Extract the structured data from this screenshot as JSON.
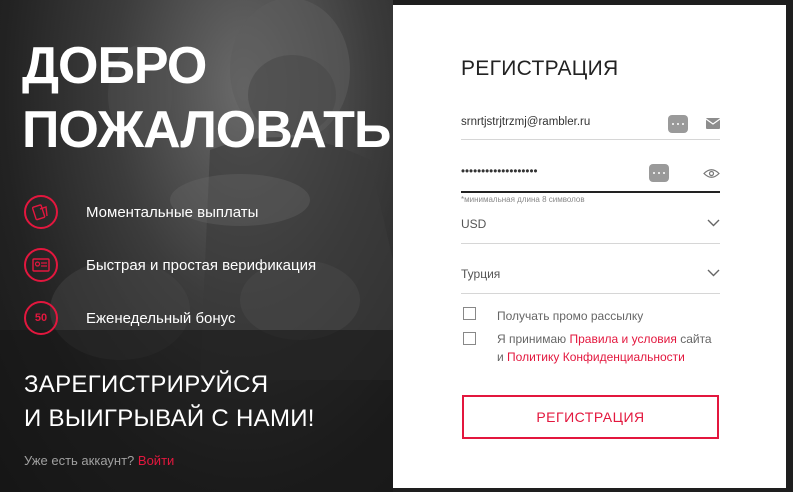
{
  "promo": {
    "title_line1": "ДОБРО",
    "title_line2": "ПОЖАЛОВАТЬ!",
    "features": [
      {
        "icon": "coins-icon",
        "text": "Моментальные выплаты"
      },
      {
        "icon": "id-card-icon",
        "text": "Быстрая и простая верификация"
      },
      {
        "icon": "fifty-percent-icon",
        "icon_text": "50",
        "text": "Еженедельный бонус"
      }
    ],
    "slogan_line1": "ЗАРЕГИСТРИРУЙСЯ",
    "slogan_line2": "И ВЫИГРЫВАЙ С НАМИ!",
    "account_prompt": "Уже есть аккаунт?",
    "login_link": "Войти"
  },
  "form": {
    "title": "РЕГИСТРАЦИЯ",
    "email_value": "srnrtjstrjtrzmj@rambler.ru",
    "password_value": "•••••••••••••••••••",
    "password_hint": "*минимальная длина 8 символов",
    "currency": "USD",
    "country": "Турция",
    "promo_checkbox_label": "Получать промо рассылку",
    "terms_prefix": "Я принимаю",
    "terms_link": "Правила и условия",
    "terms_mid": "сайта",
    "terms_and": "и",
    "privacy_link": "Политику Конфиденциальности",
    "submit_label": "РЕГИСТРАЦИЯ"
  },
  "colors": {
    "accent": "#e3173e",
    "panel_bg": "#ffffff",
    "left_bg": "#2a2a2a"
  }
}
